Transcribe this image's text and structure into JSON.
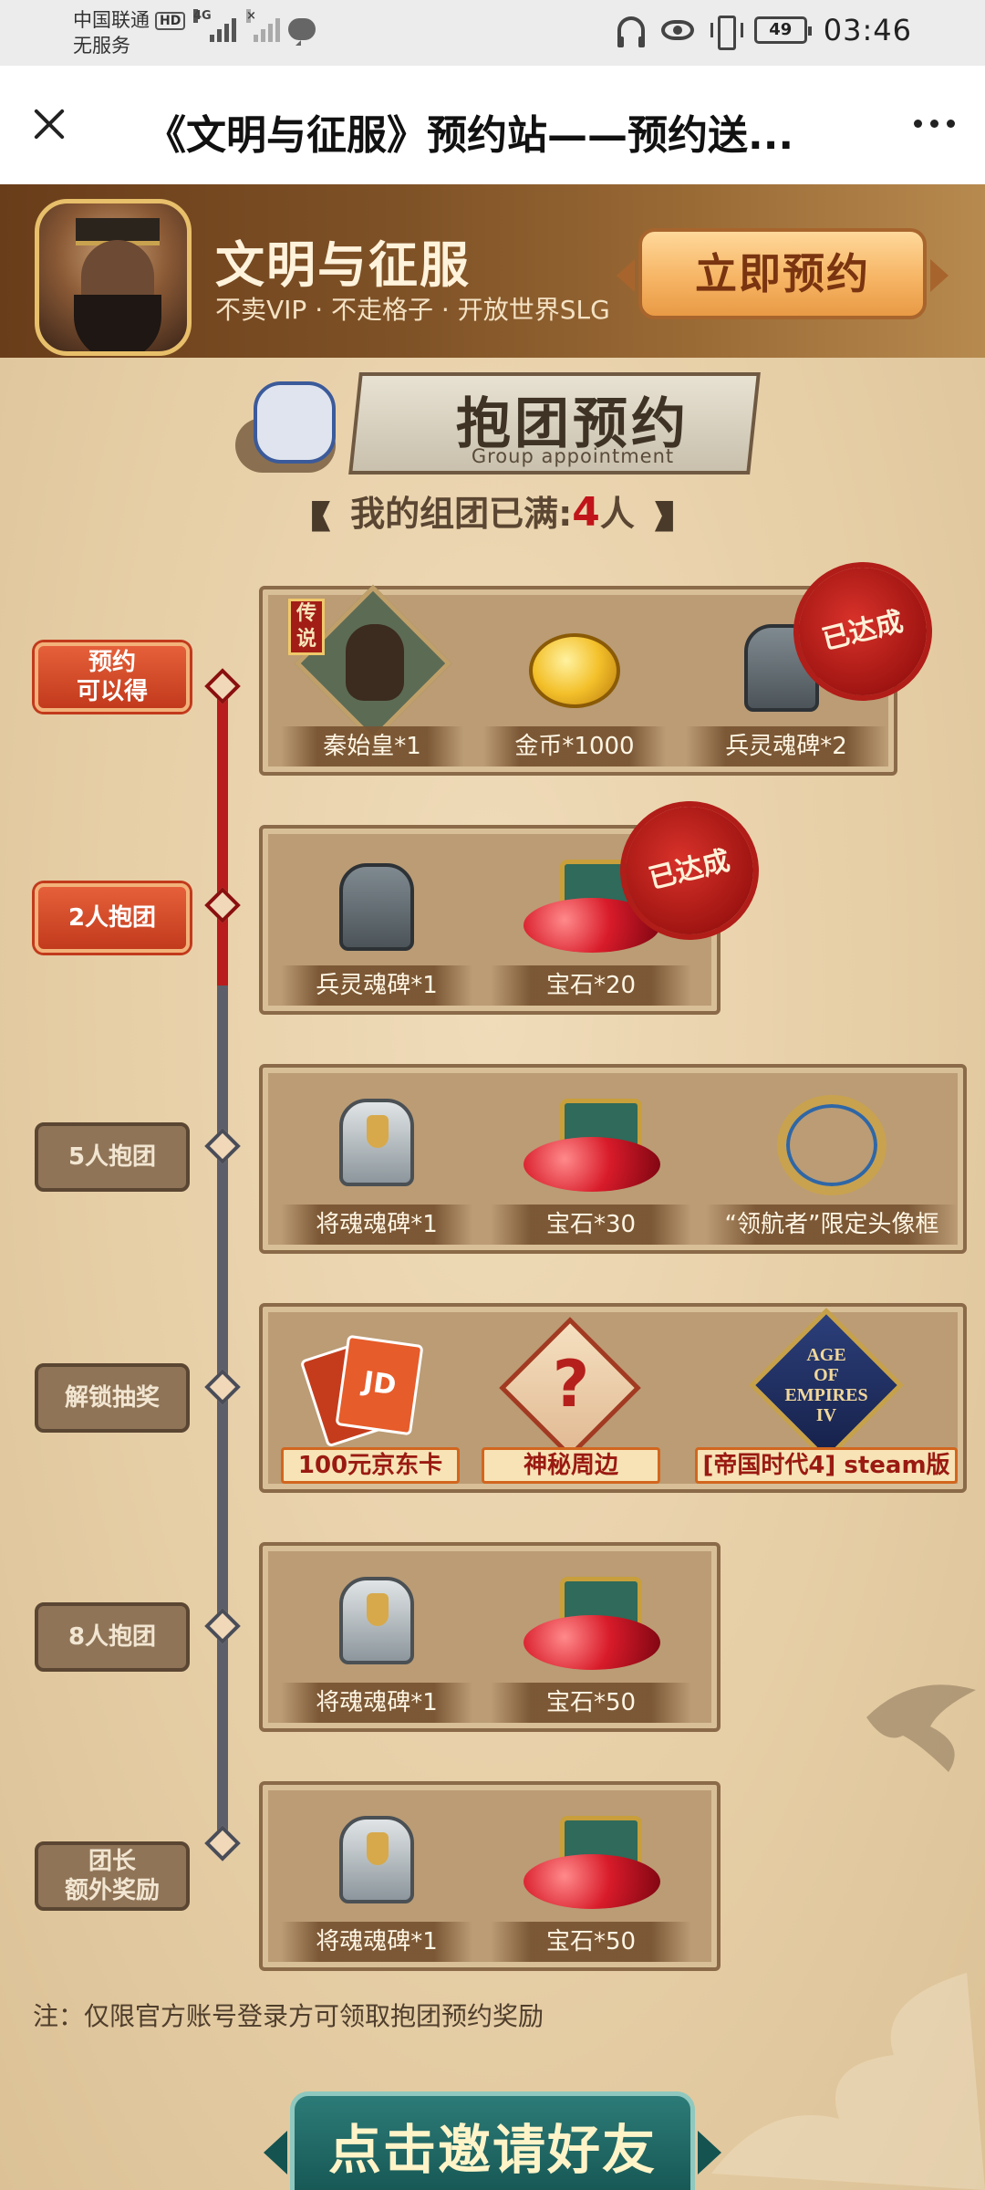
{
  "status_bar": {
    "carrier": "中国联通",
    "hd": "HD",
    "service": "无服务",
    "net1": "4G",
    "net2": "×",
    "battery": "49",
    "time": "03:46",
    "icons": [
      "headphones-icon",
      "eye-icon",
      "vibrate-icon",
      "battery-icon"
    ]
  },
  "title_bar": {
    "title": "《文明与征服》预约站——预约送...",
    "close_icon": "close-icon",
    "more_icon": "more-icon"
  },
  "header": {
    "app_name": "文明与征服",
    "tagline": "不卖VIP · 不走格子 · 开放世界SLG",
    "reserve_button": "立即预约"
  },
  "banner": {
    "title": "抱团预约",
    "subtitle": "Group appointment"
  },
  "group_status": {
    "prefix": "我的组团已满:",
    "count": "4",
    "suffix": "人"
  },
  "tiers": [
    {
      "label": "预约\n可以得",
      "achieved": true,
      "stamp": "已达成",
      "rewards": [
        {
          "name": "秦始皇*1",
          "badge": "传说"
        },
        {
          "name": "金币*1000"
        },
        {
          "name": "兵灵魂碑*2"
        }
      ]
    },
    {
      "label": "2人抱团",
      "achieved": true,
      "stamp": "已达成",
      "rewards": [
        {
          "name": "兵灵魂碑*1"
        },
        {
          "name": "宝石*20"
        }
      ]
    },
    {
      "label": "5人抱团",
      "achieved": false,
      "rewards": [
        {
          "name": "将魂魂碑*1"
        },
        {
          "name": "宝石*30"
        },
        {
          "name": "“领航者”限定头像框"
        }
      ]
    },
    {
      "label": "解锁抽奖",
      "achieved": false,
      "rewards": [
        {
          "name": "100元京东卡",
          "card_text": "JD"
        },
        {
          "name": "神秘周边",
          "symbol": "?"
        },
        {
          "name": "[帝国时代4] steam版",
          "logo_lines": [
            "AGE",
            "OF",
            "EMPIRES",
            "IV"
          ]
        }
      ]
    },
    {
      "label": "8人抱团",
      "achieved": false,
      "rewards": [
        {
          "name": "将魂魂碑*1"
        },
        {
          "name": "宝石*50"
        }
      ]
    },
    {
      "label": "团长\n额外奖励",
      "achieved": false,
      "rewards": [
        {
          "name": "将魂魂碑*1"
        },
        {
          "name": "宝石*50"
        }
      ]
    }
  ],
  "note": "注：仅限官方账号登录方可领取抱团预约奖励",
  "invite_button": "点击邀请好友",
  "colors": {
    "header_brown": "#6a3d1a",
    "reserve_orange": "#f6b565",
    "stamp_red": "#a11512",
    "timeline_red": "#b81c1c",
    "timeline_grey": "#5c5f6a",
    "invite_teal": "#145350"
  }
}
